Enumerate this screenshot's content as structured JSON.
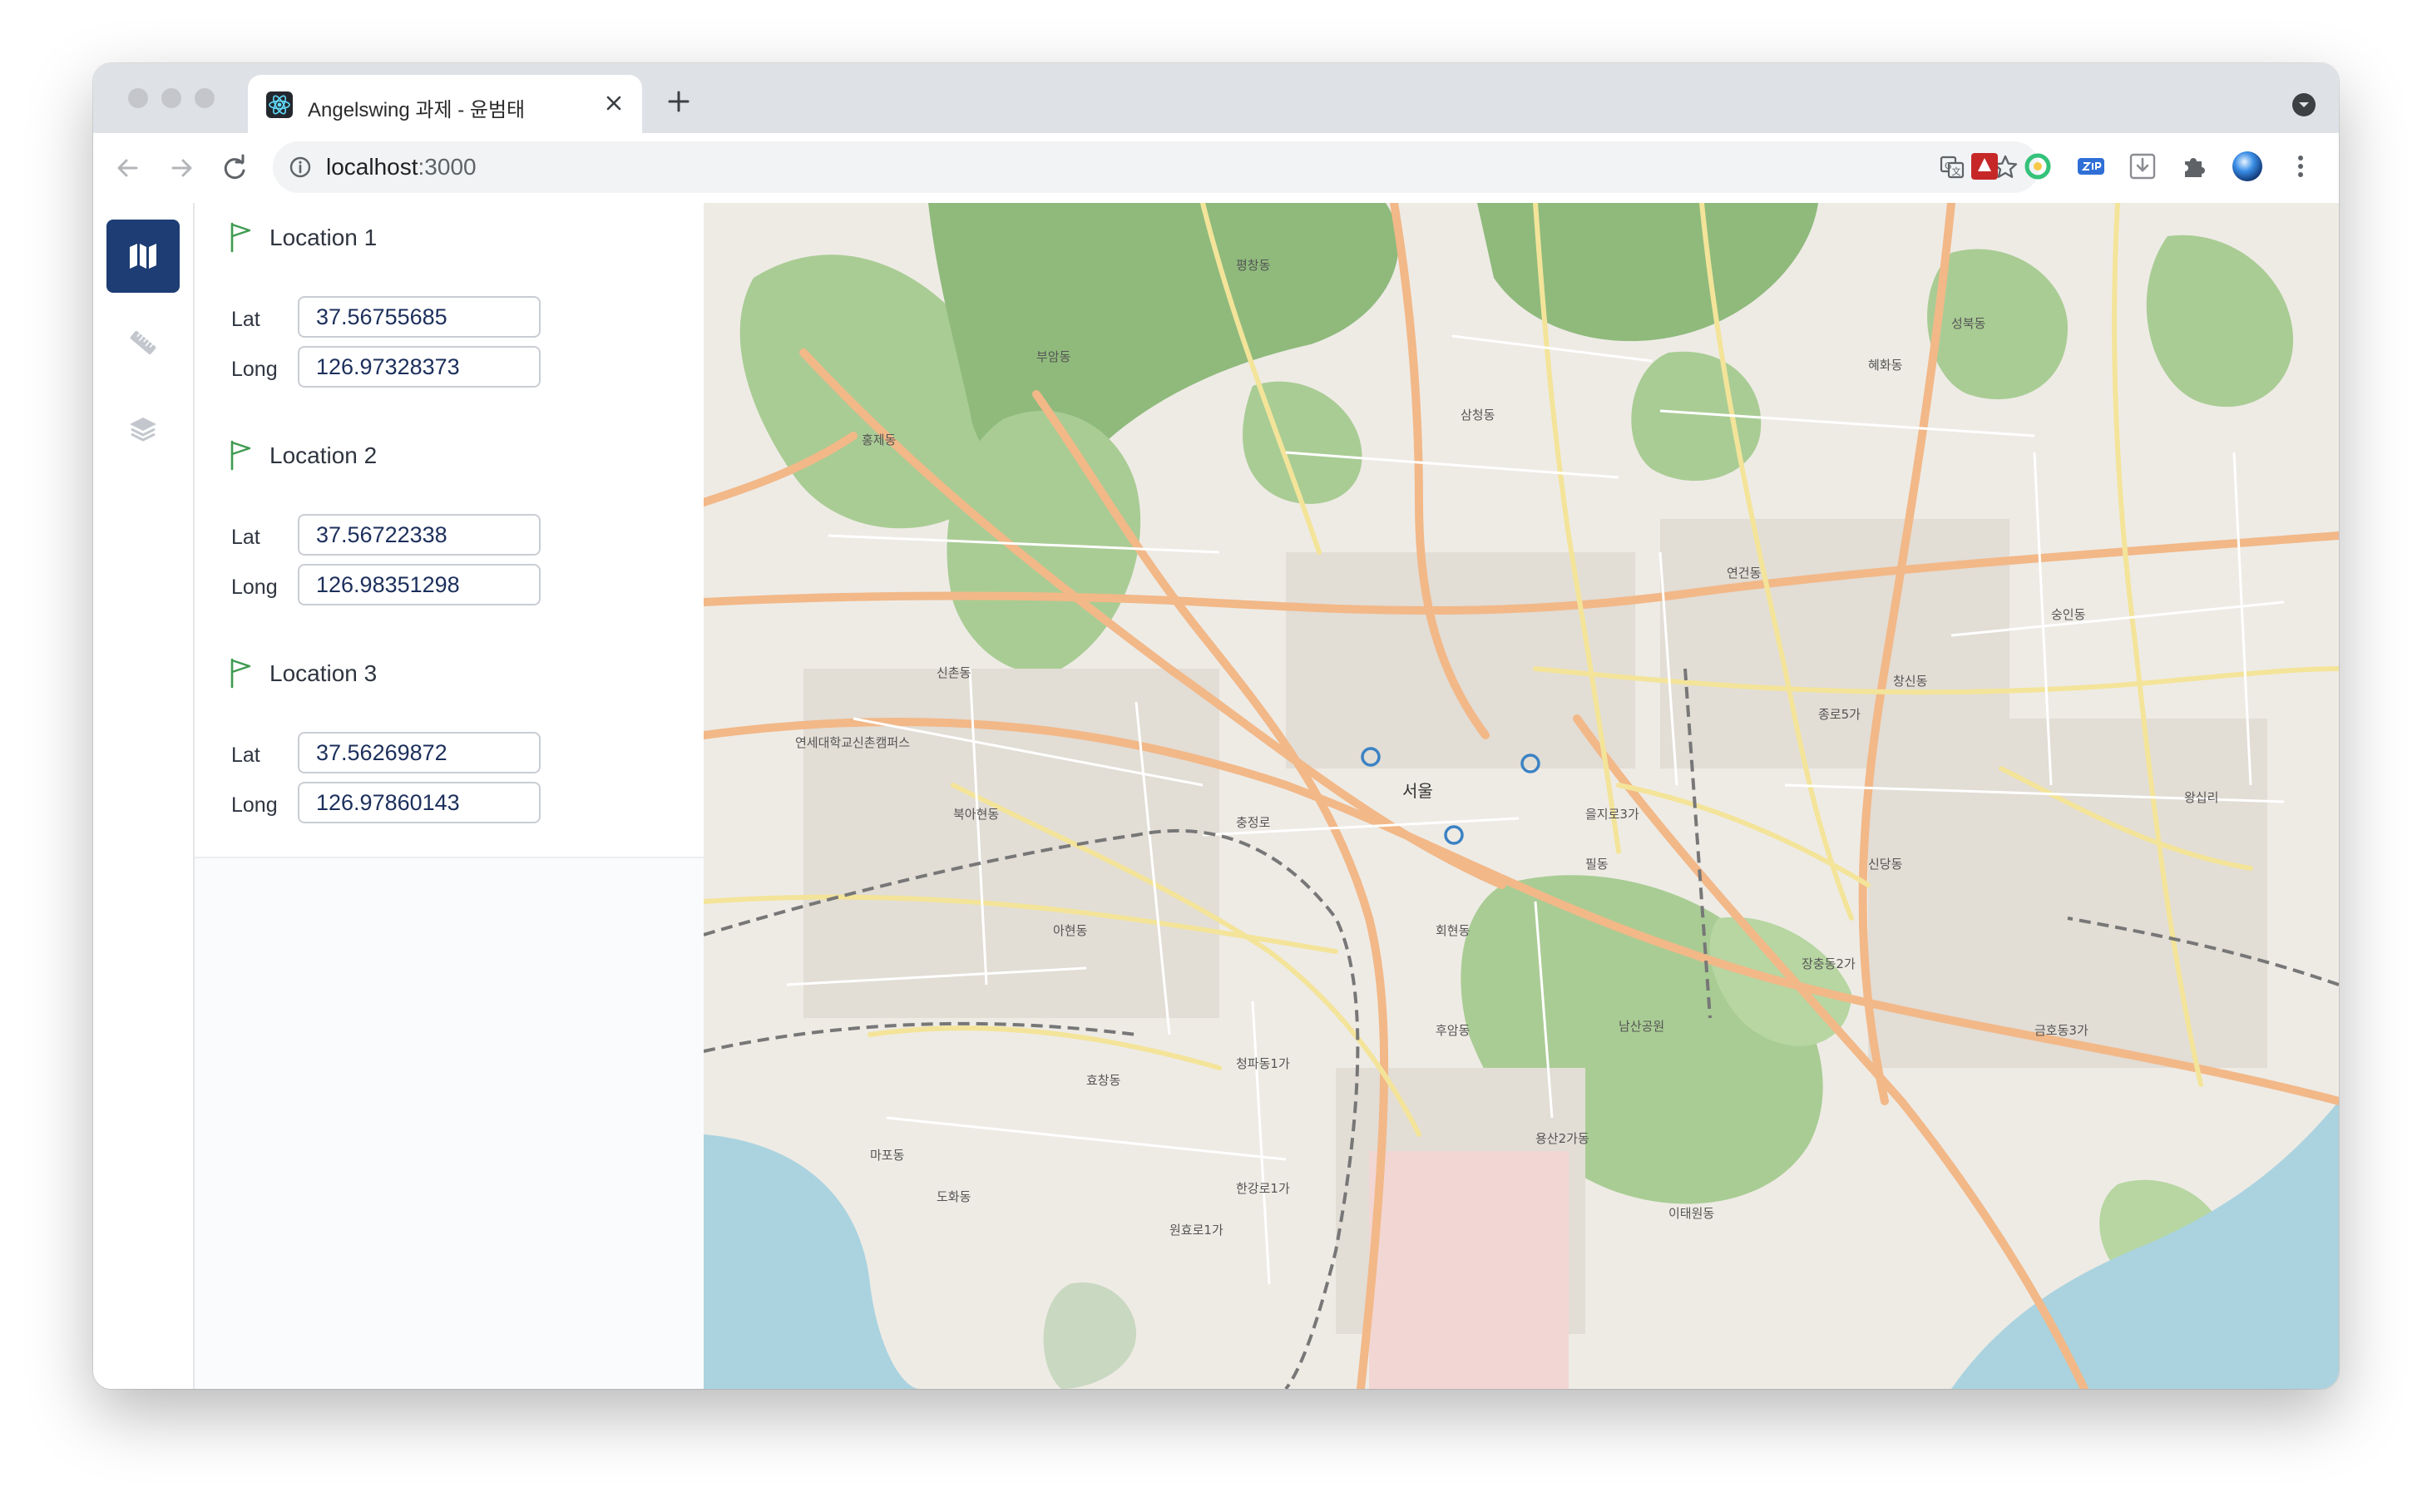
{
  "browser": {
    "tab_title": "Angelswing 과제 - 윤범태",
    "url_host": "localhost",
    "url_port": ":3000"
  },
  "sidebar": {
    "items": [
      {
        "name": "map-icon",
        "active": true
      },
      {
        "name": "ruler-icon",
        "active": false
      },
      {
        "name": "layers-icon",
        "active": false
      }
    ]
  },
  "locations": [
    {
      "title": "Location 1",
      "lat_label": "Lat",
      "long_label": "Long",
      "lat": "37.56755685",
      "long": "126.97328373"
    },
    {
      "title": "Location 2",
      "lat_label": "Lat",
      "long_label": "Long",
      "lat": "37.56722338",
      "long": "126.98351298"
    },
    {
      "title": "Location 3",
      "lat_label": "Lat",
      "long_label": "Long",
      "lat": "37.56269872",
      "long": "126.97860143"
    }
  ],
  "map": {
    "center_label": "서울",
    "labels": [
      "연세대학교신촌캠퍼스",
      "연건동",
      "이태원동",
      "남산공원",
      "용산2가동",
      "후암동",
      "회현동",
      "충정로",
      "신촌동",
      "효창동",
      "청파동1가",
      "한강로1가",
      "금호동3가",
      "왕십리",
      "신당동",
      "장충동2가",
      "필동",
      "을지로3가",
      "종로5가",
      "창신동",
      "숭인동",
      "혜화동",
      "성북동",
      "삼청동",
      "부암동",
      "평창동",
      "홍제동",
      "북아현동",
      "아현동",
      "마포동",
      "도화동",
      "원효로1가"
    ],
    "marker_color": "#3b82c4",
    "colors": {
      "land": "#eeebe5",
      "park": "#a9cc94",
      "forest": "#8fba7c",
      "water": "#aad3df",
      "major_road": "#f2b888",
      "secondary_road": "#f3e49a",
      "rail": "#777777"
    }
  }
}
